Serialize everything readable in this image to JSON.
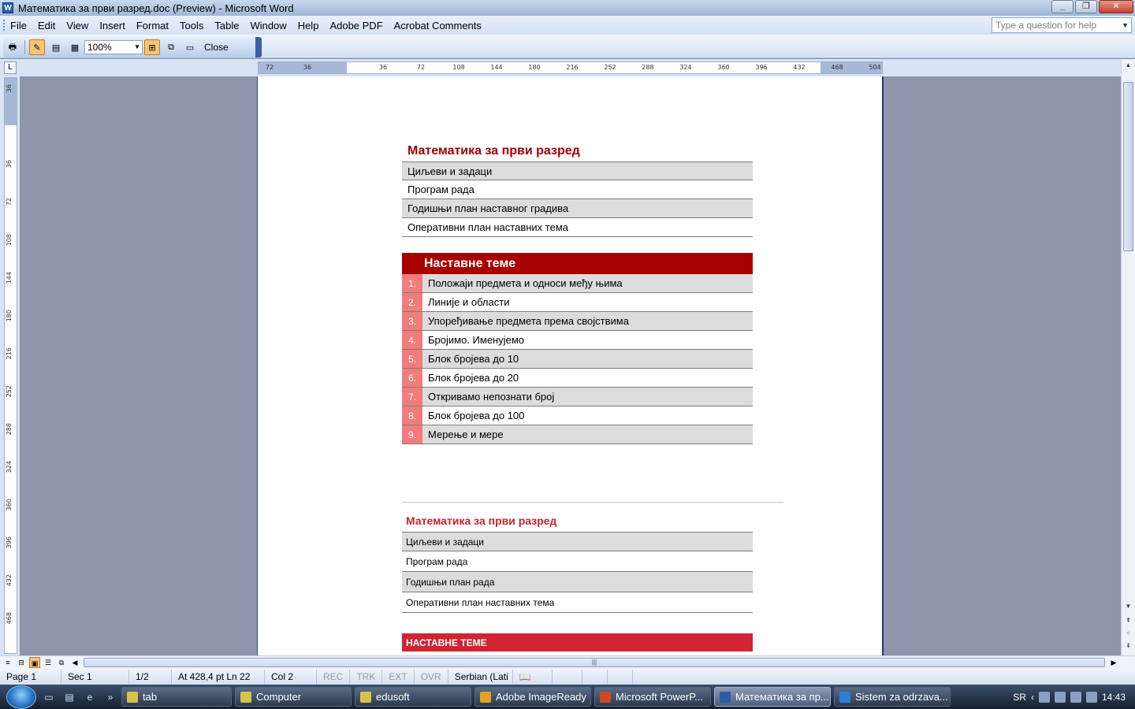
{
  "window": {
    "title": "Математика за први разред.doc (Preview) - Microsoft Word",
    "controls": {
      "minimize": "_",
      "restore": "❐",
      "close": "✕"
    }
  },
  "menu": {
    "items": [
      "File",
      "Edit",
      "View",
      "Insert",
      "Format",
      "Tools",
      "Table",
      "Window",
      "Help",
      "Adobe PDF",
      "Acrobat Comments"
    ],
    "help_placeholder": "Type a question for help"
  },
  "toolbar": {
    "zoom": "100%",
    "close_label": "Close"
  },
  "ruler": {
    "horizontal_ticks": [
      "72",
      "36",
      "36",
      "72",
      "108",
      "144",
      "180",
      "216",
      "252",
      "288",
      "324",
      "360",
      "396",
      "432",
      "468",
      "504"
    ],
    "vertical_ticks": [
      "36",
      "36",
      "72",
      "108",
      "144",
      "180",
      "216",
      "252",
      "288",
      "324",
      "360",
      "396",
      "432",
      "468"
    ]
  },
  "document": {
    "box1": {
      "title": "Математика за први разред",
      "rows": [
        "Циљеви и задаци",
        "Програм рада",
        "Годишњи план наставног градива",
        "Оперативни план наставних тема"
      ]
    },
    "themes1": {
      "header": "Наставне теме",
      "items": [
        {
          "num": "1.",
          "text": "Положаји предмета и односи међу њима"
        },
        {
          "num": "2.",
          "text": "Линије и области"
        },
        {
          "num": "3.",
          "text": "Упоређивање предмета према својствима"
        },
        {
          "num": "4.",
          "text": "Бројимо. Именујемо"
        },
        {
          "num": "5.",
          "text": "Блок бројева до 10"
        },
        {
          "num": "6.",
          "text": "Блок бројева до 20"
        },
        {
          "num": "7.",
          "text": "Откривамо непознати број"
        },
        {
          "num": "8.",
          "text": "Блок бројева до 100"
        },
        {
          "num": "9.",
          "text": "Мерење и мере"
        }
      ]
    },
    "box2": {
      "title": "Математика за први разред",
      "rows": [
        "Циљеви и задаци",
        "Програм рада",
        "Годишњи план рада",
        "Оперативни план наставних тема"
      ]
    },
    "themes2": {
      "header": "НАСТАВНЕ ТЕМЕ"
    }
  },
  "statusbar": {
    "page": "Page 1",
    "sec": "Sec 1",
    "pages": "1/2",
    "position": "At 428,4 pt  Ln 22",
    "col": "Col 2",
    "rec": "REC",
    "trk": "TRK",
    "ext": "EXT",
    "ovr": "OVR",
    "language": "Serbian (Lati"
  },
  "taskbar": {
    "tasks": [
      {
        "label": "tab",
        "icon_color": "#d8c24a"
      },
      {
        "label": "Computer",
        "icon_color": "#d8c24a"
      },
      {
        "label": "edusoft",
        "icon_color": "#d8c24a"
      },
      {
        "label": "Adobe ImageReady",
        "icon_color": "#e0a420"
      },
      {
        "label": "Microsoft PowerP...",
        "icon_color": "#d04a1e"
      },
      {
        "label": "Математика за пр...",
        "icon_color": "#2b5aa8"
      },
      {
        "label": "Sistem za odrzava...",
        "icon_color": "#2c7fd8"
      }
    ],
    "language": "SR",
    "clock": "14:43"
  }
}
